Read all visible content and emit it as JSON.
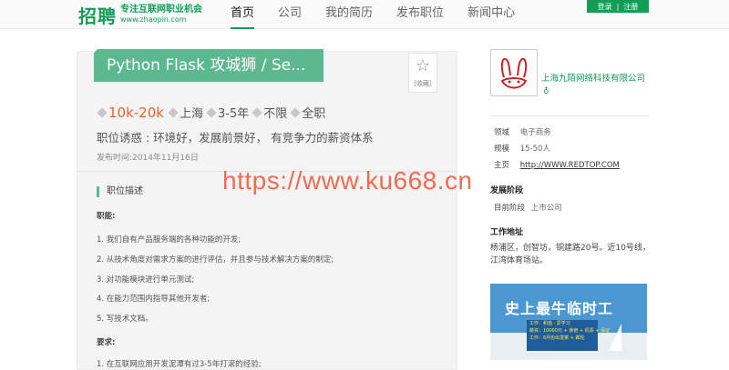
{
  "header": {
    "logo_main": "招聘",
    "logo_tagline": "专注互联网职业机会",
    "logo_domain": "www.zhaopin.com",
    "nav": [
      "首页",
      "公司",
      "我的简历",
      "发布职位",
      "新闻中心"
    ],
    "login": "登录",
    "separator": "|",
    "register": "注册"
  },
  "job": {
    "title": "Python Flask 攻城狮 / Se...",
    "favorite_label": "[收藏]",
    "salary": "10k-20k",
    "city": "上海",
    "experience": "3-5年",
    "education": "不限",
    "type": "全职",
    "lure": "职位诱惑 : 环境好，发展前景好， 有竞争力的薪资体系",
    "publish_time": "发布时间:2014年11月16日"
  },
  "description": {
    "section_title": "职位描述",
    "duties_heading": "职能:",
    "duties": [
      "1. 我们自有产品服务端的各种功能的开发;",
      "2. 从技术角度对需求方案的进行评估，并且参与技术解决方案的制定;",
      "3. 对功能模块进行单元测试;",
      "4. 在能力范围内指导其他开发者;",
      "5. 写技术文档。"
    ],
    "requirements_heading": "要求:",
    "requirements": [
      "1. 在互联网应用开发泥潭有过3-5年打滚的经验;"
    ]
  },
  "watermark": "https://www.ku668.cn",
  "company": {
    "name": "上海九陌网络科技有限公司",
    "verified_icon": "verified-icon",
    "field_label": "领域",
    "field_value": "电子商务",
    "size_label": "规模",
    "size_value": "15-50人",
    "homepage_label": "主页",
    "homepage_value": "http://WWW.REDTOP.COM",
    "stage_heading": "发展阶段",
    "stage_label": "目前阶段",
    "stage_value": "上市公司",
    "address_heading": "工作地址",
    "address": "杨浦区，创智坊，铜建路20号。近10号线，江湾体育场站。"
  },
  "banner": {
    "headline": "史上最牛临时工",
    "lines": [
      "工作：和值 · 爱学习",
      "薪资：10000元 + 食宿 + 机票 + 保证",
      "工作：6月份出发乘 + 邮轮"
    ]
  },
  "colors": {
    "brand_green": "#119d55",
    "ribbon_green": "#5cb88f",
    "salary_orange": "#e4632b",
    "watermark_red": "#f26b52"
  }
}
